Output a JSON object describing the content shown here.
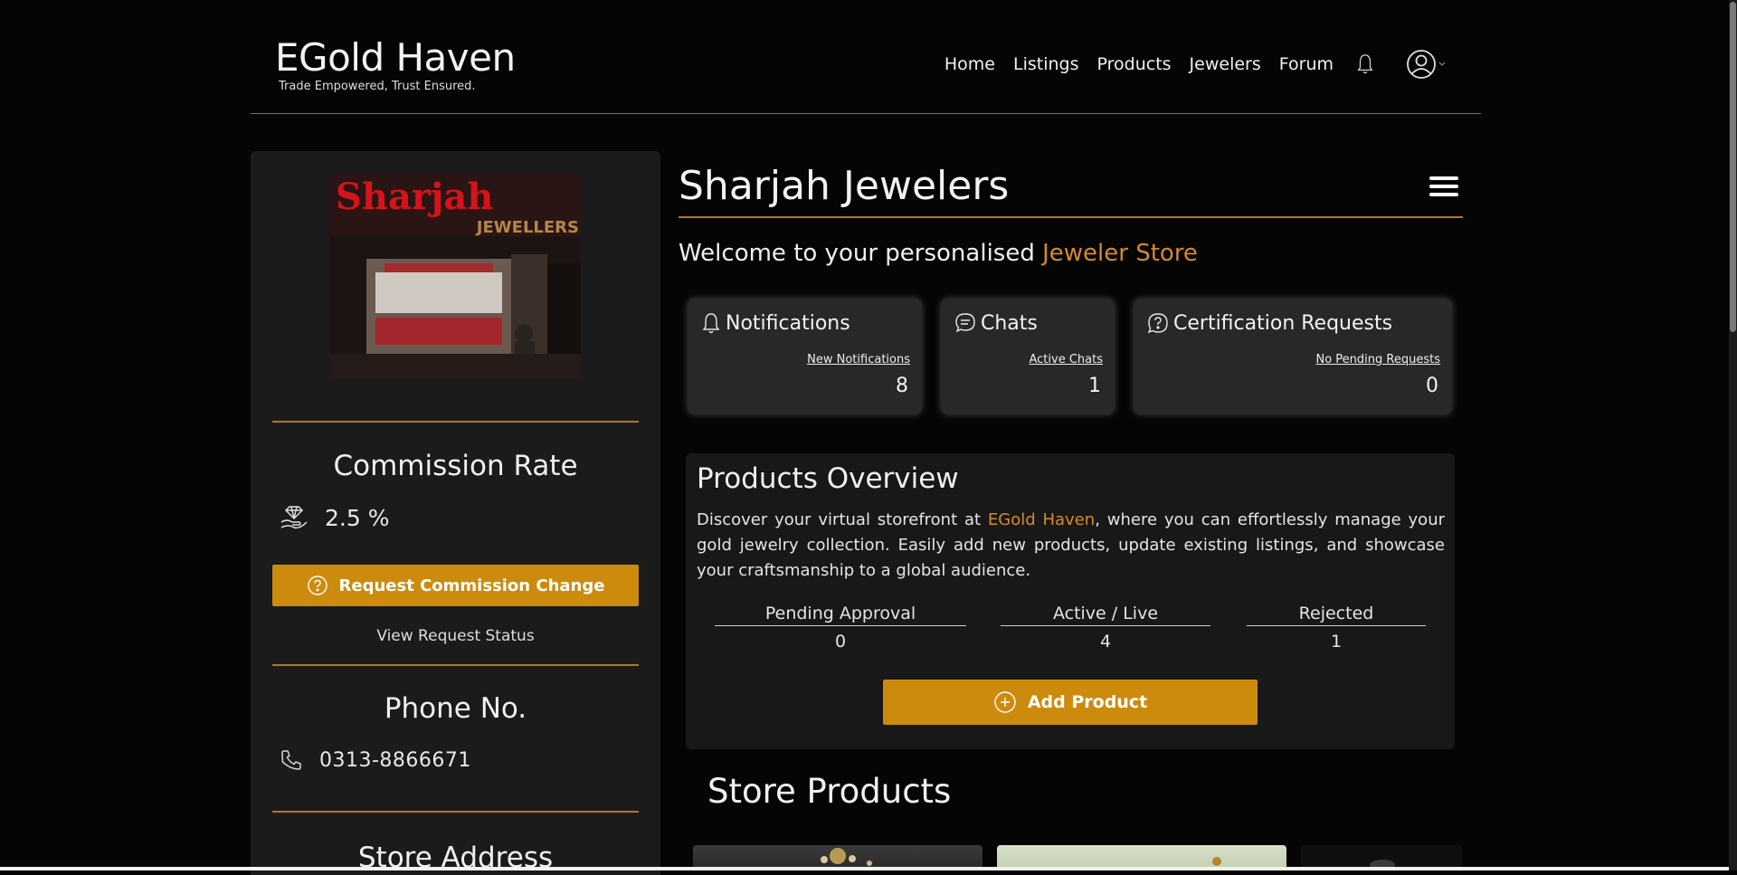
{
  "header": {
    "logo_title": "EGold Haven",
    "logo_tagline": "Trade Empowered, Trust Ensured.",
    "nav": [
      "Home",
      "Listings",
      "Products",
      "Jewelers",
      "Forum"
    ]
  },
  "sidebar": {
    "photo_sign_title": "Sharjah",
    "photo_sign_sub": "JEWELLERS",
    "commission_heading": "Commission Rate",
    "commission_value": "2.5 %",
    "request_button": "Request Commission Change",
    "view_status": "View Request Status",
    "phone_heading": "Phone No.",
    "phone_value": "0313-8866671",
    "address_heading": "Store Address"
  },
  "main": {
    "title": "Sharjah Jewelers",
    "welcome_prefix": "Welcome to your personalised",
    "welcome_accent": "Jeweler Store",
    "cards": [
      {
        "title": "Notifications",
        "link": "New Notifications",
        "count": "8",
        "icon": "bell-icon"
      },
      {
        "title": "Chats",
        "link": "Active Chats",
        "count": "1",
        "icon": "chat-icon"
      },
      {
        "title": "Certification Requests",
        "link": "No Pending Requests",
        "count": "0",
        "icon": "question-icon"
      }
    ],
    "overview": {
      "title": "Products Overview",
      "desc_prefix": "Discover your virtual storefront at",
      "desc_accent": "EGold Haven",
      "desc_suffix": ", where you can effortlessly manage your gold jewelry collection. Easily add new products, update existing listings, and showcase your craftsmanship to a global audience.",
      "stats": [
        {
          "label": "Pending Approval",
          "value": "0"
        },
        {
          "label": "Active / Live",
          "value": "4"
        },
        {
          "label": "Rejected",
          "value": "1"
        }
      ],
      "add_button": "Add Product"
    },
    "store_products_title": "Store Products"
  },
  "colors": {
    "accent": "#cc8b0d",
    "accent_text": "#d48a2c",
    "background": "#050505",
    "panel": "#1b1b1b"
  }
}
